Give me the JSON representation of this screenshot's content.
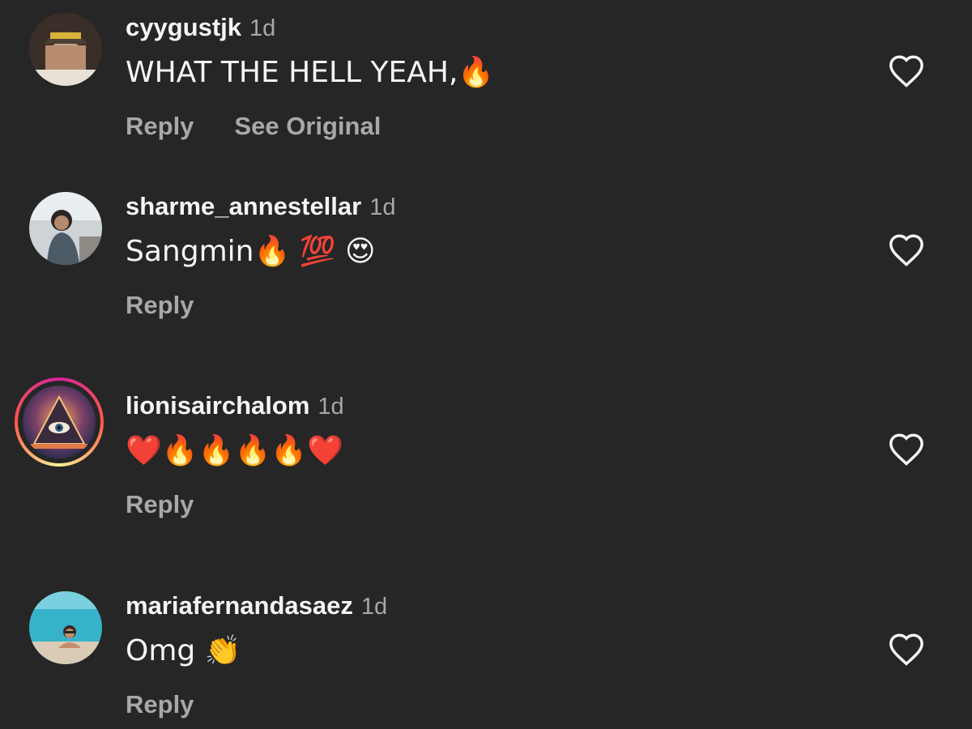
{
  "comments": [
    {
      "username": "cyygustjk",
      "time": "1d",
      "text": "WHAT THE HELL YEAH,🔥",
      "actions": [
        "Reply",
        "See Original"
      ],
      "avatar_icon": "user-avatar-cap"
    },
    {
      "username": "sharme_annestellar",
      "time": "1d",
      "text": "Sangmin🔥 💯 😍",
      "actions": [
        "Reply"
      ],
      "avatar_icon": "user-avatar-car"
    },
    {
      "username": "lionisairchalom",
      "time": "1d",
      "text": "❤️🔥🔥🔥🔥❤️",
      "actions": [
        "Reply"
      ],
      "avatar_icon": "user-avatar-eye-pyramid"
    },
    {
      "username": "mariafernandasaez",
      "time": "1d",
      "text": "Omg 👏",
      "actions": [
        "Reply"
      ],
      "avatar_icon": "user-avatar-pool"
    }
  ],
  "icons": {
    "like": "heart-outline-icon"
  },
  "colors": {
    "background": "#262626",
    "primary_text": "#f5f5f5",
    "secondary_text": "#a8a8a8",
    "story_ring": "#d6249f"
  }
}
